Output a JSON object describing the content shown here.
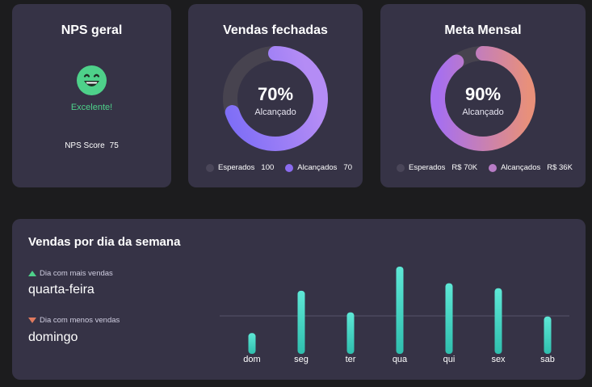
{
  "nps": {
    "title": "NPS geral",
    "icon": "smiley-icon",
    "status": "Excelente!",
    "score_label": "NPS Score",
    "score_value": "75",
    "status_color": "#4ed18a"
  },
  "vendas": {
    "title": "Vendas fechadas",
    "percent": "70%",
    "percent_value": 70,
    "sub": "Alcançado",
    "legend": [
      {
        "label": "Esperados",
        "value": "100",
        "color": "#4a4659"
      },
      {
        "label": "Alcançados",
        "value": "70",
        "color": "#8b6cf0"
      }
    ]
  },
  "meta": {
    "title": "Meta Mensal",
    "percent": "90%",
    "percent_value": 90,
    "sub": "Alcançado",
    "legend": [
      {
        "label": "Esperados",
        "value": "R$ 70K",
        "color": "#4a4659"
      },
      {
        "label": "Alcançados",
        "value": "R$ 36K",
        "color": "#b87cc6"
      }
    ]
  },
  "semana": {
    "title": "Vendas por dia da semana",
    "best_label": "Dia com mais vendas",
    "best_day": "quarta-feira",
    "worst_label": "Dia com menos vendas",
    "worst_day": "domingo"
  },
  "chart_data": {
    "type": "bar",
    "categories": [
      "dom",
      "seg",
      "ter",
      "qua",
      "qui",
      "sex",
      "sab"
    ],
    "values": [
      25,
      76,
      50,
      105,
      85,
      79,
      45
    ],
    "bar_color": "#45d6c4",
    "title": "Vendas por dia da semana",
    "xlabel": "",
    "ylabel": ""
  }
}
